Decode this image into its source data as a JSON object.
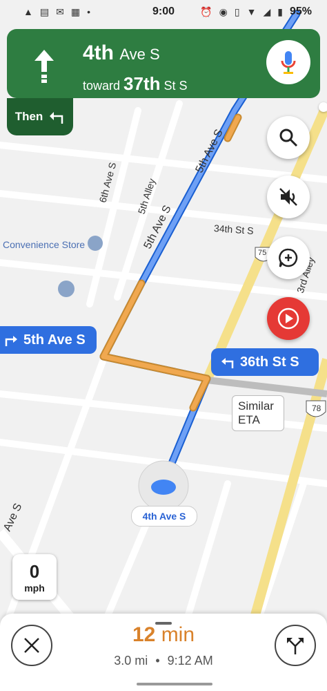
{
  "status_bar": {
    "time": "9:00",
    "battery": "95%"
  },
  "nav_banner": {
    "street_name": "4th",
    "street_suffix": "Ave S",
    "toward_prefix": "toward",
    "toward_street": "37th",
    "toward_suffix": "St S",
    "then_label": "Then"
  },
  "map": {
    "poi_label": "Convenience Store",
    "street_labels": {
      "fifth_ave_s_a": "5th Ave S",
      "fifth_ave_s_b": "5th Ave S",
      "sixth_ave_s": "6th Ave S",
      "fifth_alley": "5th Alley",
      "third_alley": "3rd Alley",
      "thirty_fourth": "34th St S",
      "ave_s_partial": "Ave S",
      "route_75": "75",
      "route_78": "78"
    },
    "callouts": {
      "left": "5th Ave S",
      "right": "36th St S"
    },
    "eta_bubble": {
      "line1": "Similar",
      "line2": "ETA"
    },
    "current_street": "4th Ave S"
  },
  "speed": {
    "value": "0",
    "unit": "mph"
  },
  "trip": {
    "minutes_value": "12",
    "minutes_unit": "min",
    "distance": "3.0 mi",
    "separator": "•",
    "arrival": "9:12 AM"
  },
  "icons": [
    "search-icon",
    "mute-icon",
    "add-report-icon",
    "youtube-music-icon",
    "mic-icon",
    "close-icon",
    "alternate-route-icon"
  ]
}
